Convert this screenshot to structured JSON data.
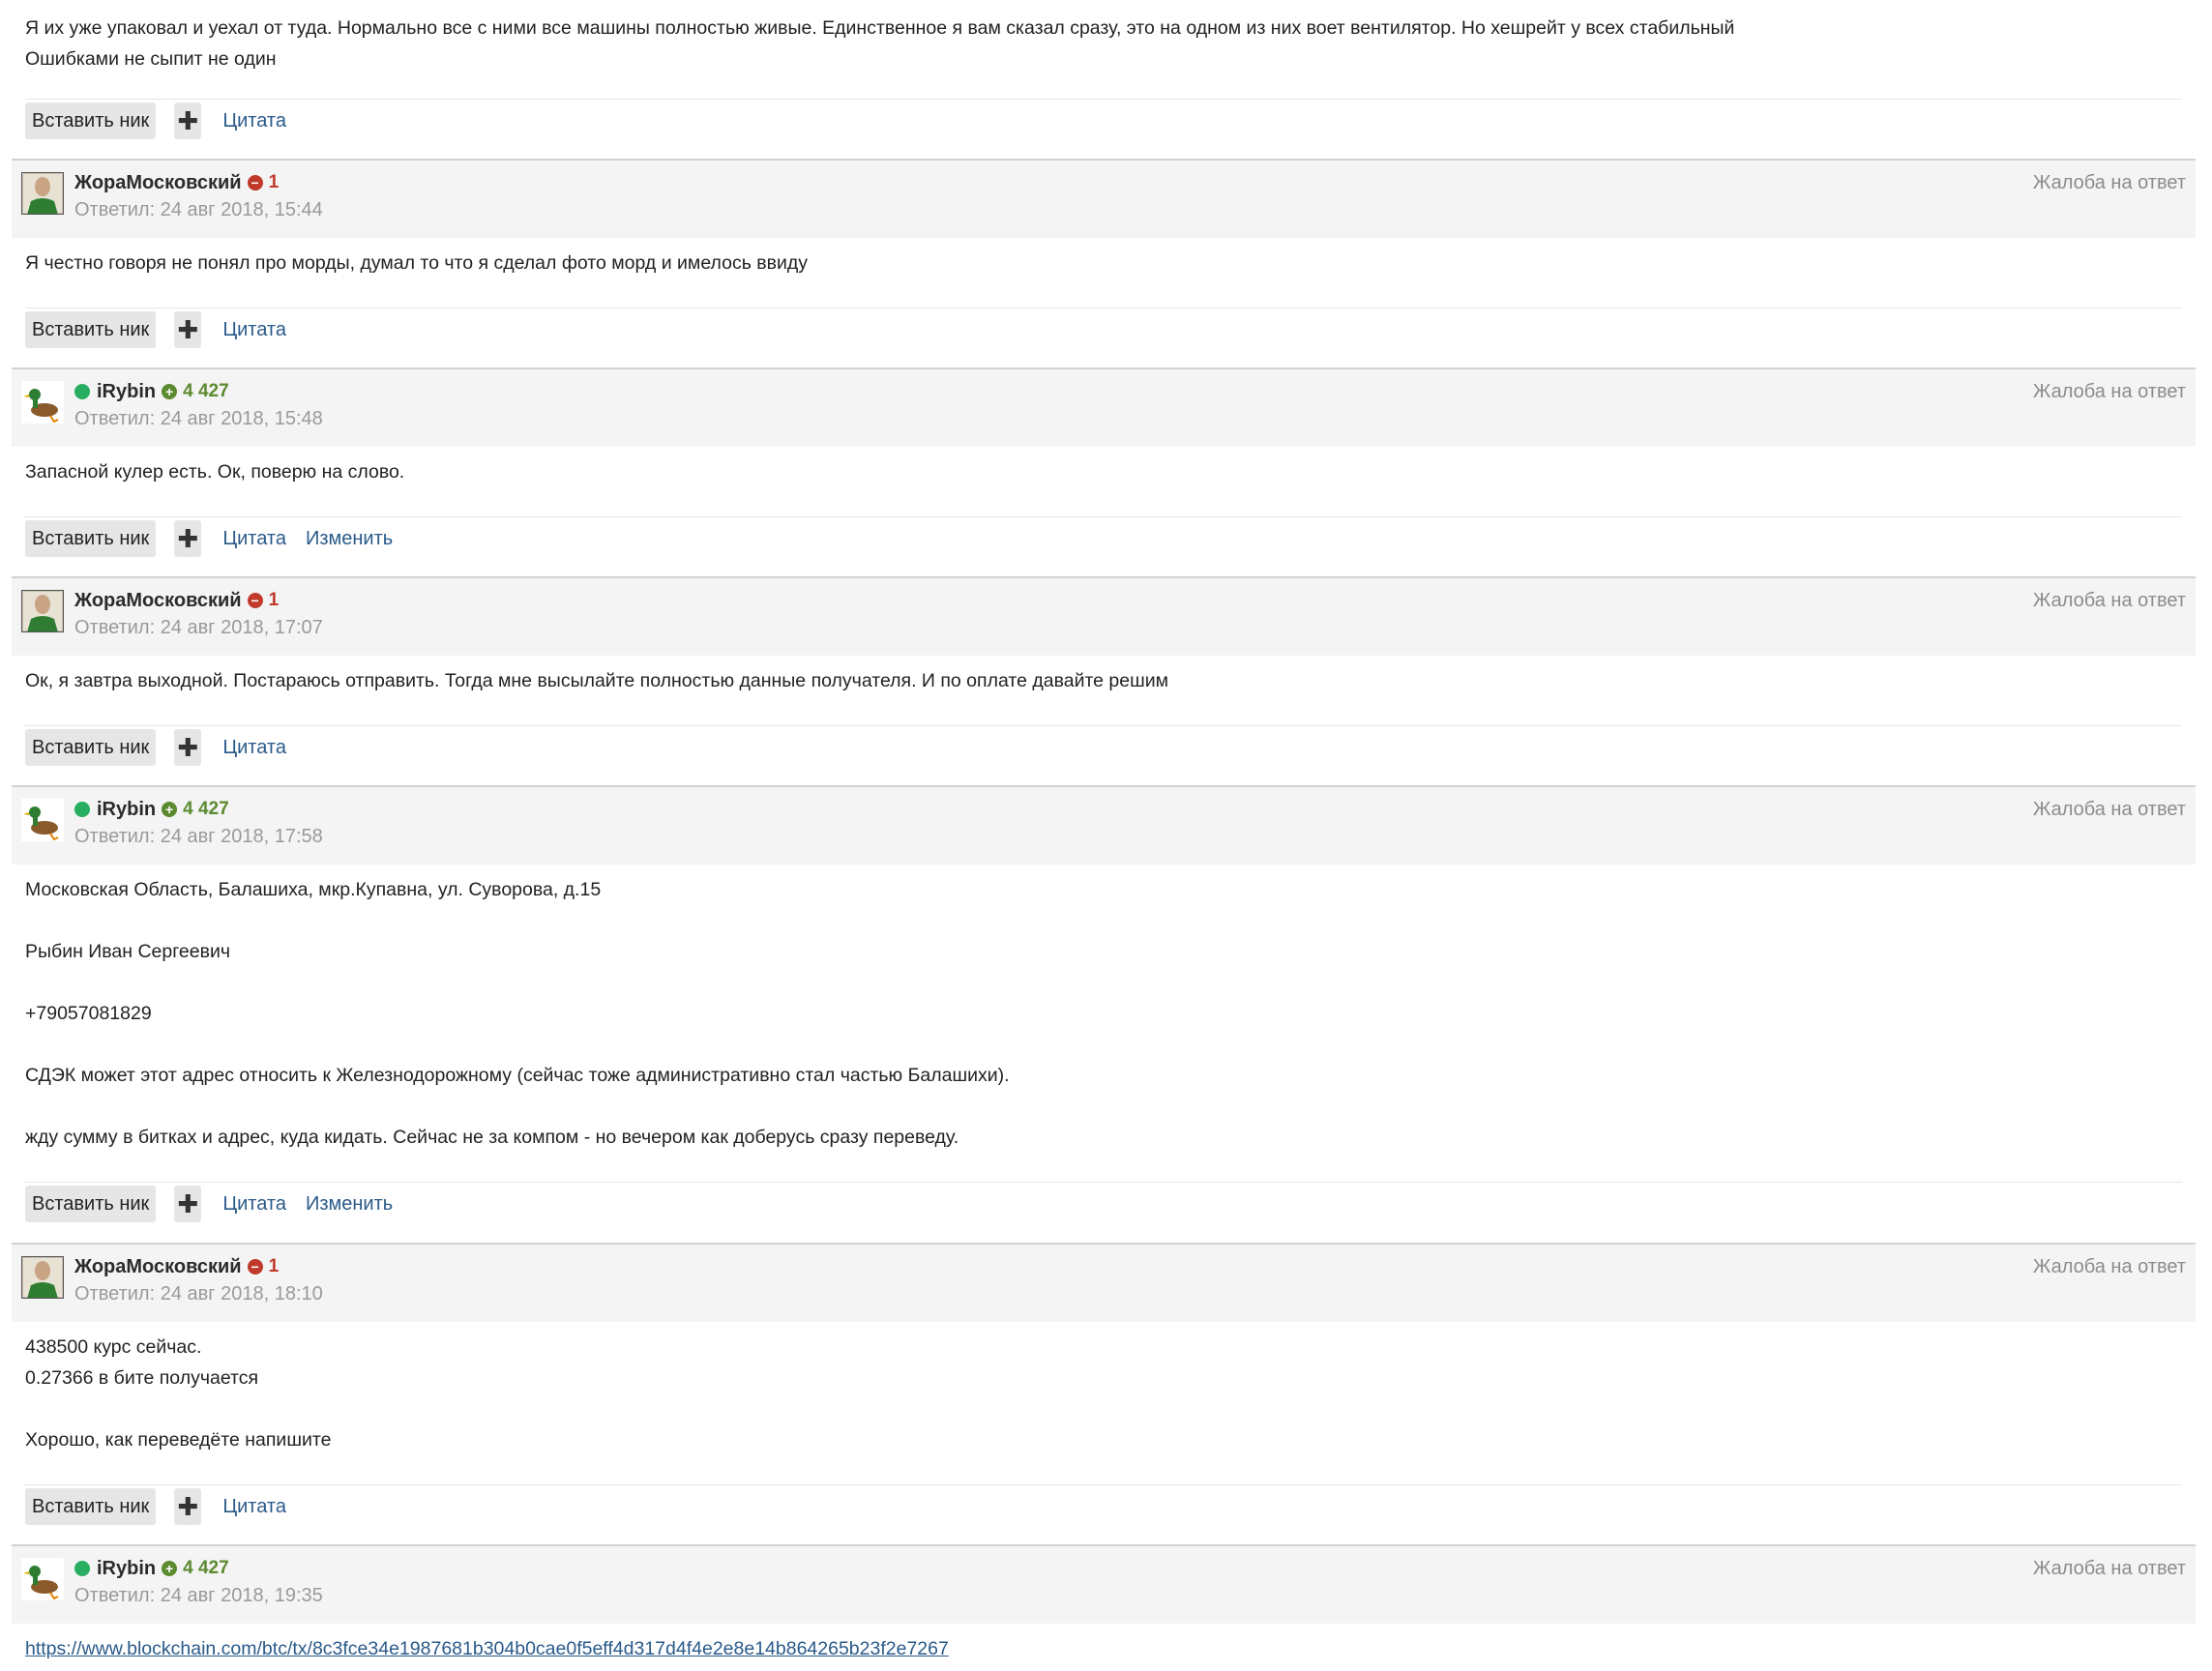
{
  "labels": {
    "insert_nick": "Вставить ник",
    "plus": "✚",
    "quote": "Цитата",
    "edit": "Изменить",
    "complaint": "Жалоба на ответ"
  },
  "top_post": {
    "lines": [
      "Я их уже упаковал и уехал от туда. Нормально все с ними все машины полностью живые. Единственное я вам сказал сразу, это на одном из них воет вентилятор. Но хешрейт у всех стабильный",
      "Ошибками не сыпит не один"
    ]
  },
  "posts": [
    {
      "author": "ЖораМосковский",
      "online": false,
      "rep_sign": "neg",
      "rep": "1",
      "replied": "Ответил: 24 авг 2018, 15:44",
      "body": [
        "Я честно говоря не понял про морды, думал то что я сделал фото морд и имелось ввиду"
      ],
      "can_edit": false
    },
    {
      "author": "iRybin",
      "online": true,
      "rep_sign": "pos",
      "rep": "4 427",
      "replied": "Ответил: 24 авг 2018, 15:48",
      "body": [
        "Запасной кулер есть. Ок, поверю на слово."
      ],
      "can_edit": true
    },
    {
      "author": "ЖораМосковский",
      "online": false,
      "rep_sign": "neg",
      "rep": "1",
      "replied": "Ответил: 24 авг 2018, 17:07",
      "body": [
        "Ок, я завтра выходной. Постараюсь отправить. Тогда мне высылайте полностью данные получателя. И по оплате давайте решим"
      ],
      "can_edit": false
    },
    {
      "author": "iRybin",
      "online": true,
      "rep_sign": "pos",
      "rep": "4 427",
      "replied": "Ответил: 24 авг 2018, 17:58",
      "body": [
        "Московская Область, Балашиха, мкр.Купавна, ул. Суворова, д.15",
        "",
        "Рыбин Иван Сергеевич",
        "",
        "+79057081829",
        "",
        "СДЭК может этот адрес относить к Железнодорожному (сейчас тоже административно стал частью Балашихи).",
        "",
        "жду сумму в битках и адрес, куда кидать. Сейчас не за компом - но вечером как доберусь сразу переведу."
      ],
      "can_edit": true
    },
    {
      "author": "ЖораМосковский",
      "online": false,
      "rep_sign": "neg",
      "rep": "1",
      "replied": "Ответил: 24 авг 2018, 18:10",
      "body": [
        "438500 курс сейчас.",
        "0.27366 в бите получается",
        "",
        "Хорошо, как переведёте напишите"
      ],
      "can_edit": false
    },
    {
      "author": "iRybin",
      "online": true,
      "rep_sign": "pos",
      "rep": "4 427",
      "replied": "Ответил: 24 авг 2018, 19:35",
      "link": "https://www.blockchain.com/btc/tx/8c3fce34e1987681b304b0cae0f5eff4d317d4f4e2e8e14b864265b23f2e7267",
      "can_edit": false
    }
  ]
}
